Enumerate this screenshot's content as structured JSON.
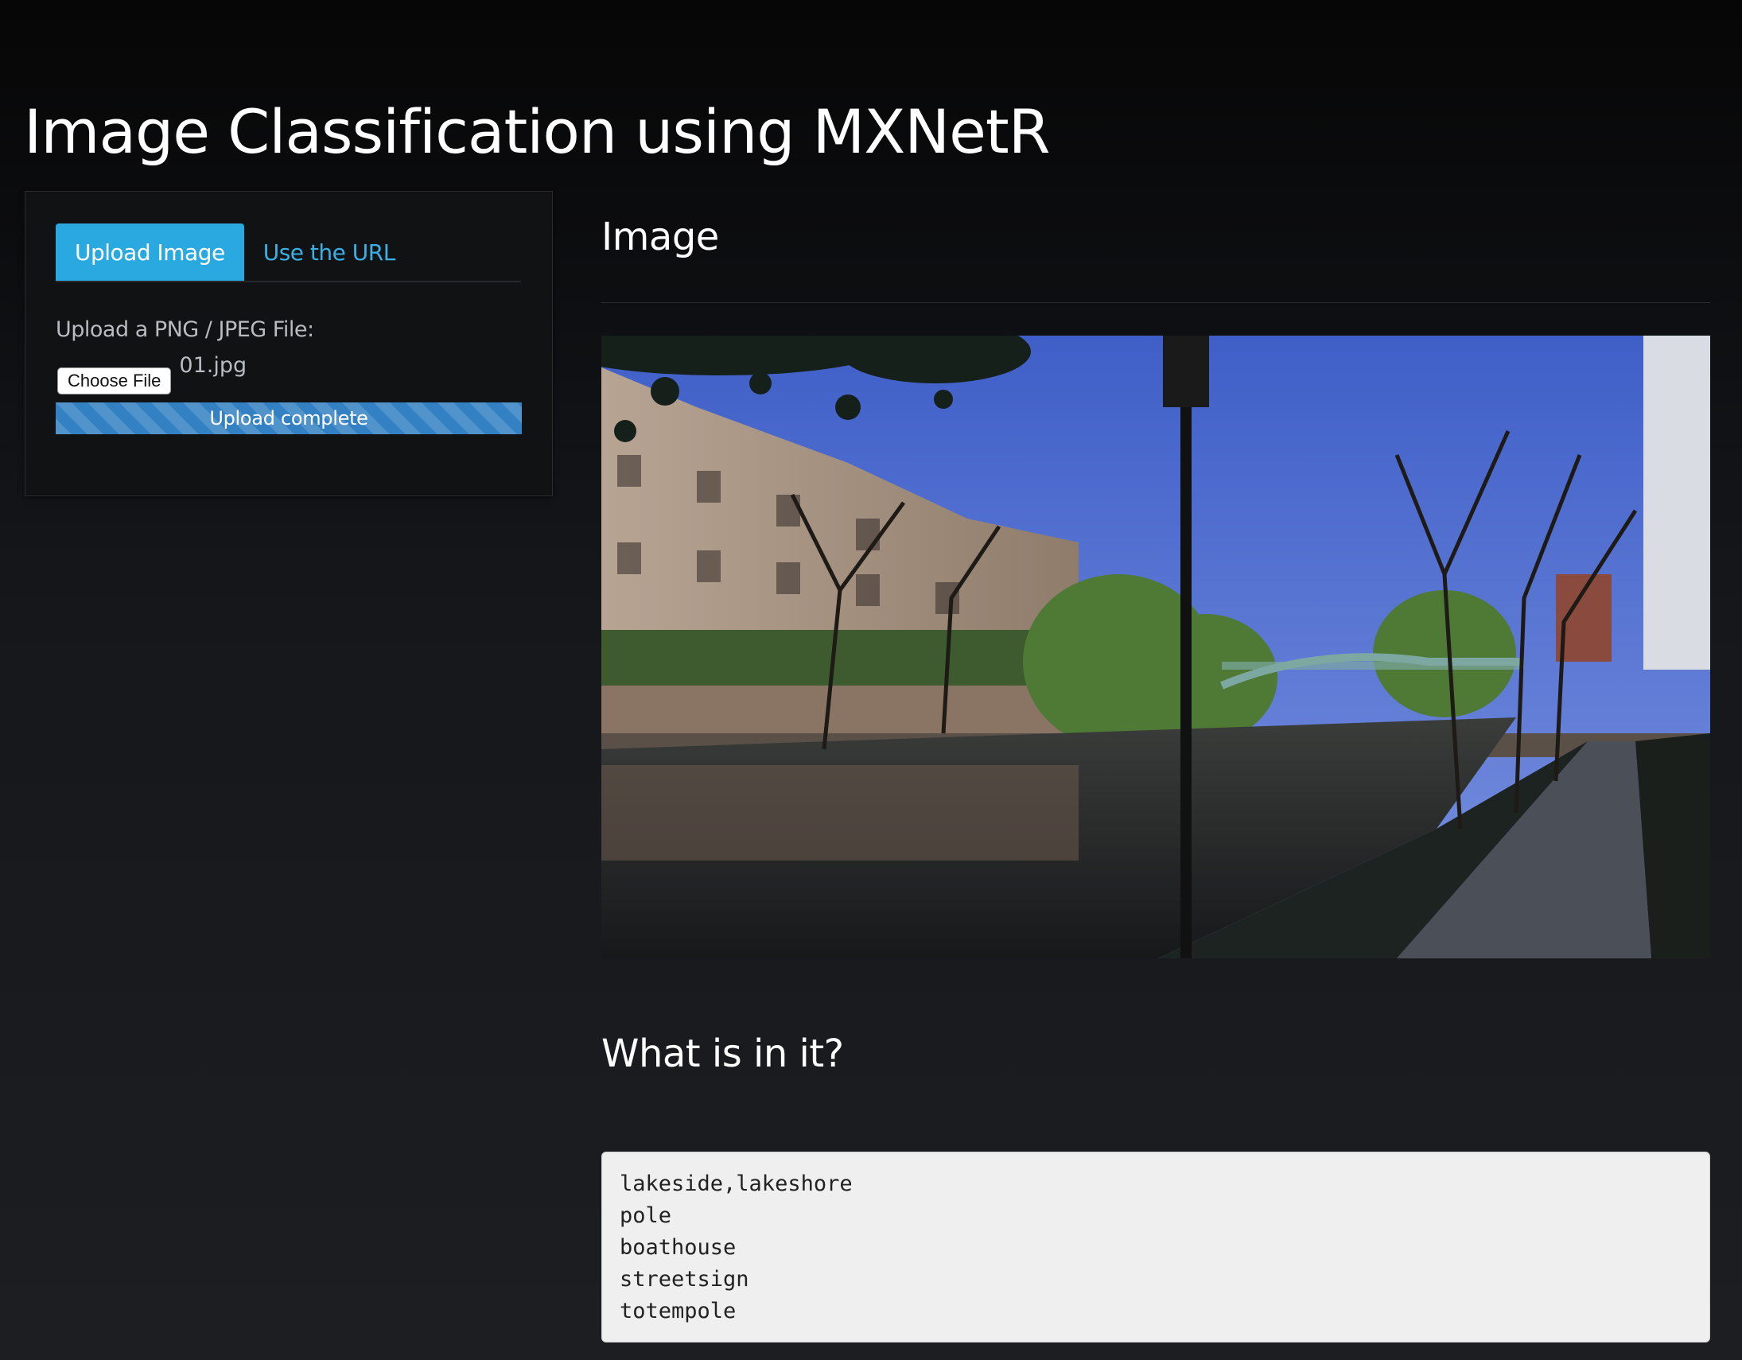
{
  "page": {
    "title": "Image Classification using MXNetR"
  },
  "sidebar": {
    "tabs": [
      {
        "label": "Upload Image",
        "active": true
      },
      {
        "label": "Use the URL",
        "active": false
      }
    ],
    "upload_label": "Upload a PNG / JPEG File:",
    "choose_file_label": "Choose File",
    "file_name": "01.jpg",
    "progress": {
      "label": "Upload complete",
      "percent": 100
    }
  },
  "main": {
    "image_heading": "Image",
    "results_heading": "What is in it?",
    "predictions": [
      "lakeside,lakeshore",
      "pole",
      "boathouse",
      "streetsign",
      "totempole"
    ]
  },
  "colors": {
    "accent": "#2aa9e0",
    "progress": "#3380c2",
    "background": "#1c1e22"
  }
}
